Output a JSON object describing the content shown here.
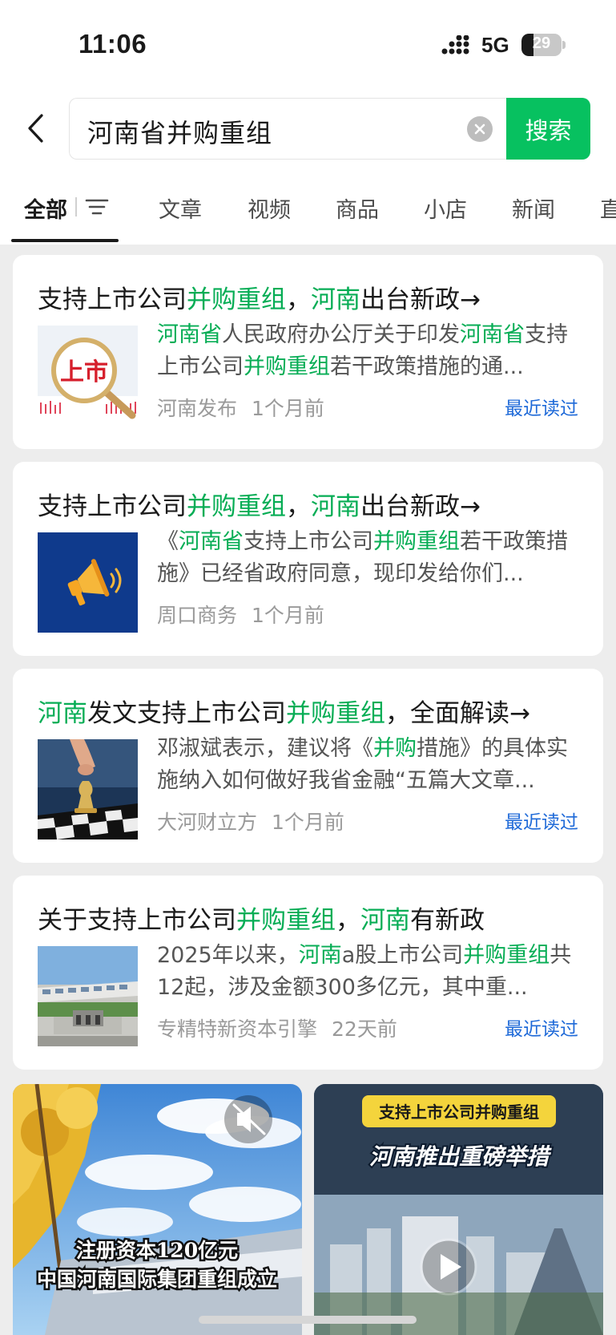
{
  "status_bar": {
    "time": "11:06",
    "network": "5G",
    "battery_percent": 29,
    "battery_label": "29"
  },
  "search": {
    "query": "河南省并购重组",
    "button_label": "搜索"
  },
  "tabs": [
    {
      "label": "全部",
      "active": true
    },
    {
      "label": "文章"
    },
    {
      "label": "视频"
    },
    {
      "label": "商品"
    },
    {
      "label": "小店"
    },
    {
      "label": "新闻"
    },
    {
      "label": "直"
    }
  ],
  "results": [
    {
      "title_parts": [
        {
          "text": "支持上市公司",
          "hl": false
        },
        {
          "text": "并购重组",
          "hl": true
        },
        {
          "text": "，",
          "hl": false
        },
        {
          "text": "河南",
          "hl": true
        },
        {
          "text": "出台新政→",
          "hl": false
        }
      ],
      "snippet_parts": [
        {
          "text": "河南省",
          "hl": true
        },
        {
          "text": "人民政府办公厅关于印发",
          "hl": false
        },
        {
          "text": "河南省",
          "hl": true
        },
        {
          "text": "支持上市公司",
          "hl": false
        },
        {
          "text": "并购重组",
          "hl": true
        },
        {
          "text": "若干政策措施的通...",
          "hl": false
        }
      ],
      "thumb_text": "上市",
      "source": "河南发布",
      "time": "1个月前",
      "tag": "最近读过"
    },
    {
      "title_parts": [
        {
          "text": "支持上市公司",
          "hl": false
        },
        {
          "text": "并购重组",
          "hl": true
        },
        {
          "text": "，",
          "hl": false
        },
        {
          "text": "河南",
          "hl": true
        },
        {
          "text": "出台新政→",
          "hl": false
        }
      ],
      "snippet_parts": [
        {
          "text": "《",
          "hl": false
        },
        {
          "text": "河南省",
          "hl": true
        },
        {
          "text": "支持上市公司",
          "hl": false
        },
        {
          "text": "并购重组",
          "hl": true
        },
        {
          "text": "若干政策措施》已经省政府同意，现印发给你们...",
          "hl": false
        }
      ],
      "source": "周口商务",
      "time": "1个月前",
      "tag": ""
    },
    {
      "title_parts": [
        {
          "text": "河南",
          "hl": true
        },
        {
          "text": "发文支持上市公司",
          "hl": false
        },
        {
          "text": "并购重组",
          "hl": true
        },
        {
          "text": "，全面解读→",
          "hl": false
        }
      ],
      "snippet_parts": [
        {
          "text": "邓淑斌表示，建议将《",
          "hl": false
        },
        {
          "text": "并购",
          "hl": true
        },
        {
          "text": "措施》的具体实施纳入如何做好我省金融“五篇大文章...",
          "hl": false
        }
      ],
      "source": "大河财立方",
      "time": "1个月前",
      "tag": "最近读过"
    },
    {
      "title_parts": [
        {
          "text": "关于支持上市公司",
          "hl": false
        },
        {
          "text": "并购重组",
          "hl": true
        },
        {
          "text": "，",
          "hl": false
        },
        {
          "text": "河南",
          "hl": true
        },
        {
          "text": "有新政",
          "hl": false
        }
      ],
      "snippet_parts": [
        {
          "text": "2025年以来，",
          "hl": false
        },
        {
          "text": "河南",
          "hl": true
        },
        {
          "text": "a股上市公司",
          "hl": false
        },
        {
          "text": "并购重组",
          "hl": true
        },
        {
          "text": "共12起，涉及金额300多亿元，其中重...",
          "hl": false
        }
      ],
      "source": "专精特新资本引擎",
      "time": "22天前",
      "tag": "最近读过"
    }
  ],
  "videos": [
    {
      "caption_line1": "注册资本120亿元",
      "caption_line2": "中国河南国际集团重组成立"
    },
    {
      "banner": "支持上市公司并购重组",
      "headline": "河南推出重磅举措"
    }
  ],
  "colors": {
    "accent_green": "#07c160",
    "highlight_green": "#07ad55",
    "link_blue": "#1f6ad8",
    "page_bg": "#ededed"
  }
}
